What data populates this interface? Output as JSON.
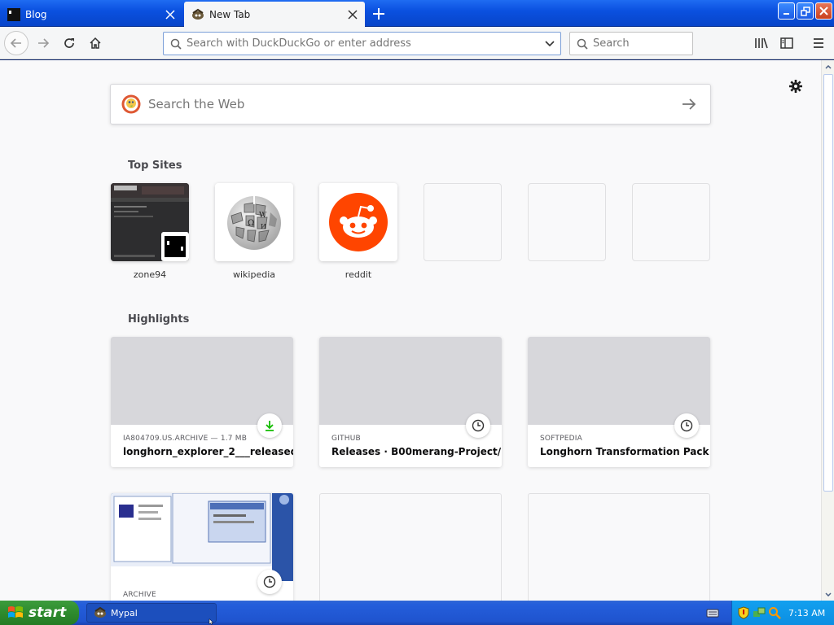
{
  "tabs": [
    {
      "label": "Blog",
      "active": false
    },
    {
      "label": "New Tab",
      "active": true
    }
  ],
  "navbar": {
    "url_placeholder": "Search with DuckDuckGo or enter address",
    "search_placeholder": "Search"
  },
  "newtab": {
    "web_search_placeholder": "Search the Web",
    "top_sites_title": "Top Sites",
    "top_sites": [
      {
        "name": "zone94",
        "icon": "zone94-thumbnail"
      },
      {
        "name": "wikipedia",
        "icon": "wikipedia-globe-icon"
      },
      {
        "name": "reddit",
        "icon": "reddit-icon"
      },
      {
        "name": ""
      },
      {
        "name": ""
      },
      {
        "name": ""
      }
    ],
    "highlights_title": "Highlights",
    "highlights": [
      {
        "source": "IA804709.US.ARCHIVE — 1.7 MB",
        "title": "longhorn_explorer_2___released...",
        "badge": "download-icon"
      },
      {
        "source": "GITHUB",
        "title": "Releases · B00merang-Project/...",
        "badge": "clock-icon"
      },
      {
        "source": "SOFTPEDIA",
        "title": "Longhorn Transformation Pack -...",
        "badge": "clock-icon"
      },
      {
        "source": "ARCHIVE",
        "title": "",
        "badge": "clock-icon"
      }
    ]
  },
  "taskbar": {
    "start_label": "start",
    "task_label": "Mypal",
    "clock": "7:13 AM"
  },
  "colors": {
    "titlebar": "#0b51e0",
    "reddit": "#ff4500",
    "download_green": "#12bc00",
    "start_green": "#2e8b2e"
  }
}
